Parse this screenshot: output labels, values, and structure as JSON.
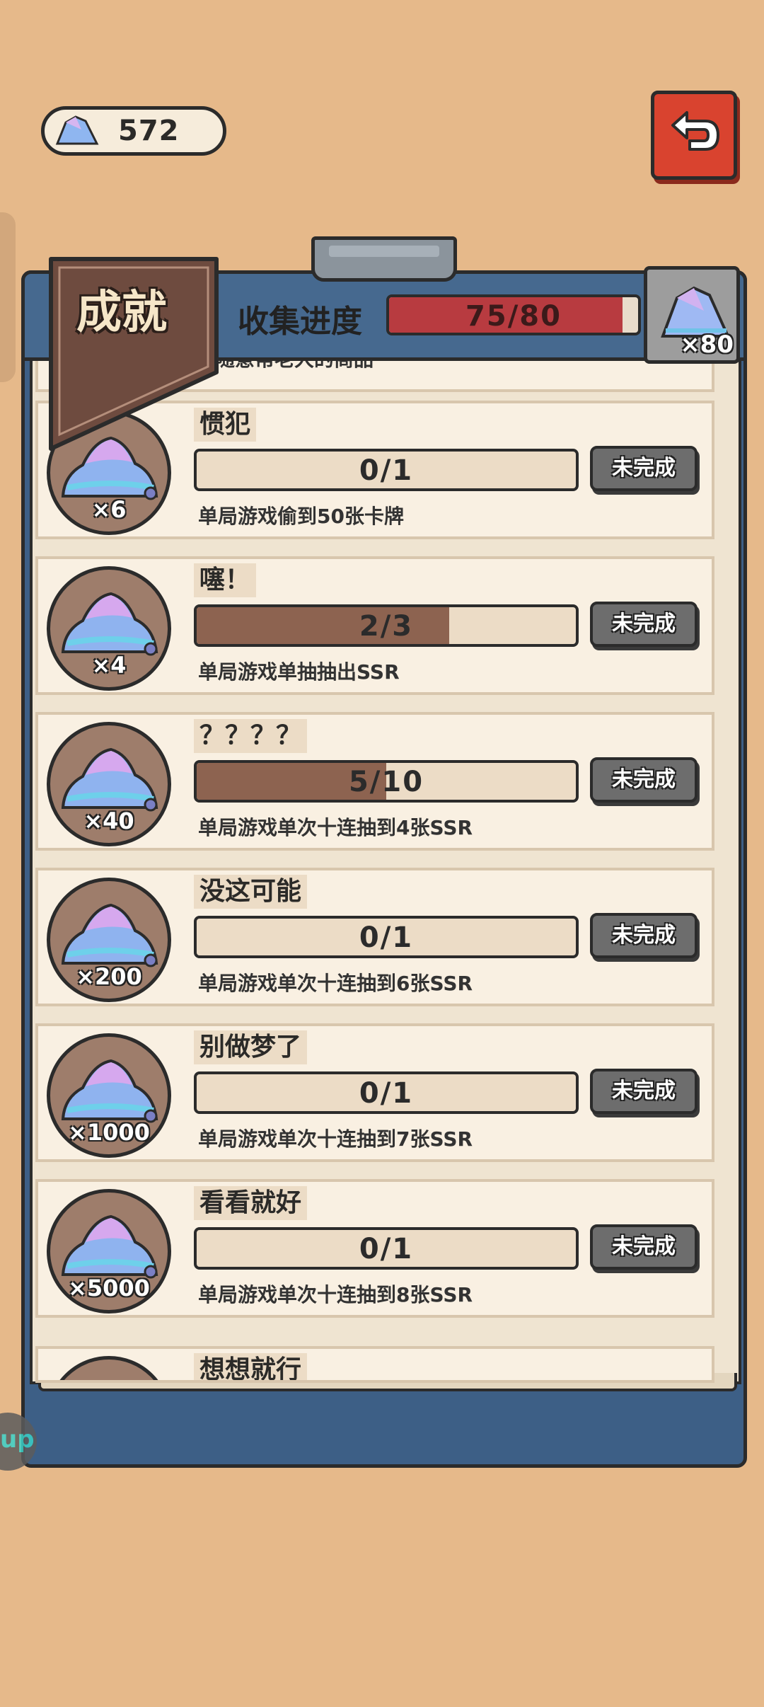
{
  "currency": {
    "amount": "572",
    "icon": "gem-icon"
  },
  "back": {
    "icon": "return-arrow-icon"
  },
  "float_tab": {
    "label": "up"
  },
  "header": {
    "banner_title": "成就",
    "collect_label": "收集进度",
    "progress_text": "75/80",
    "progress_value": 0.9375,
    "reward_count": "×80"
  },
  "partial_top": {
    "desc": "随意帮老大的商品"
  },
  "cards": [
    {
      "reward": "×6",
      "title": "惯犯",
      "progress": "0/1",
      "current": 0,
      "total": 1,
      "desc": "单局游戏偷到50张卡牌",
      "status": "未完成"
    },
    {
      "reward": "×4",
      "title": "噻！",
      "progress": "2/3",
      "current": 2,
      "total": 3,
      "desc": "单局游戏单抽抽出SSR",
      "status": "未完成"
    },
    {
      "reward": "×40",
      "title": "？？？？",
      "progress": "5/10",
      "current": 5,
      "total": 10,
      "desc": "单局游戏单次十连抽到4张SSR",
      "status": "未完成"
    },
    {
      "reward": "×200",
      "title": "没这可能",
      "progress": "0/1",
      "current": 0,
      "total": 1,
      "desc": "单局游戏单次十连抽到6张SSR",
      "status": "未完成"
    },
    {
      "reward": "×1000",
      "title": "别做梦了",
      "progress": "0/1",
      "current": 0,
      "total": 1,
      "desc": "单局游戏单次十连抽到7张SSR",
      "status": "未完成"
    },
    {
      "reward": "×5000",
      "title": "看看就好",
      "progress": "0/1",
      "current": 0,
      "total": 1,
      "desc": "单局游戏单次十连抽到8张SSR",
      "status": "未完成"
    }
  ],
  "partial_bottom": {
    "title": "想想就行"
  },
  "colors": {
    "background": "#e6b98a",
    "board": "#3d5f86",
    "accent_red": "#d9432f",
    "bar_red": "#b83b40",
    "bar_brown": "#8d6350"
  }
}
